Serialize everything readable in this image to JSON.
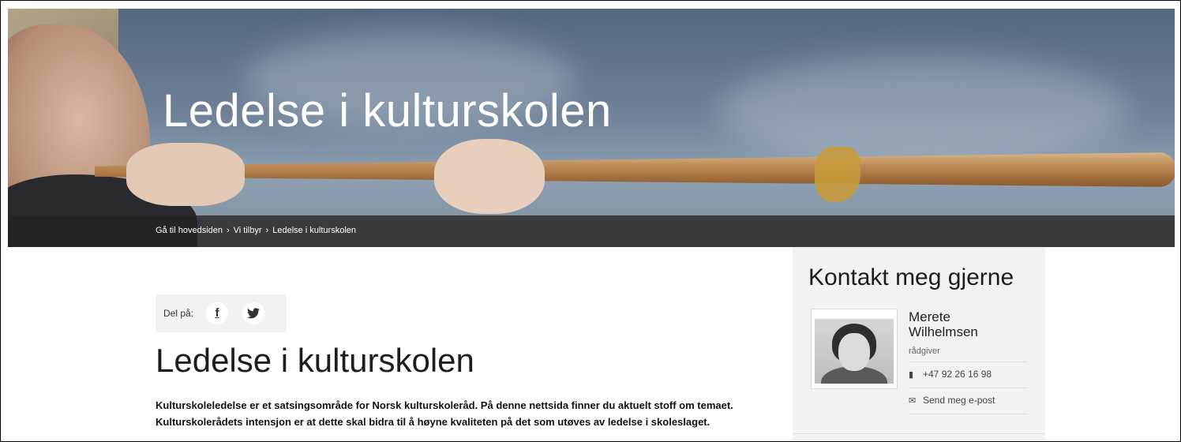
{
  "hero": {
    "title": "Ledelse i kulturskolen"
  },
  "breadcrumb": {
    "items": [
      "Gå til hovedsiden",
      "Vi tilbyr",
      "Ledelse i kulturskolen"
    ],
    "separator": "›"
  },
  "share": {
    "label": "Del på:",
    "facebook_glyph": "f",
    "twitter_glyph": "🐦",
    "icons": [
      "facebook-icon",
      "twitter-icon"
    ]
  },
  "article": {
    "title": "Ledelse i kulturskolen",
    "lead": "Kulturskoleledelse er et satsingsområde for Norsk kulturskoleråd. På denne nettsida finner du aktuelt stoff om temaet. Kulturskolerådets intensjon er at dette skal bidra til å høyne kvaliteten på det som utøves av ledelse i skoleslaget."
  },
  "contact": {
    "heading": "Kontakt meg gjerne",
    "name": "Merete Wilhelmsen",
    "role": "rådgiver",
    "phone": "+47 92 26 16 98",
    "email_label": "Send meg e-post",
    "phone_icon": "▮",
    "email_icon": "✉"
  },
  "colors": {
    "breadcrumb_bar": "#232323",
    "sidebar_bg": "#f2f2f2",
    "share_bg": "#f2f2f2"
  }
}
